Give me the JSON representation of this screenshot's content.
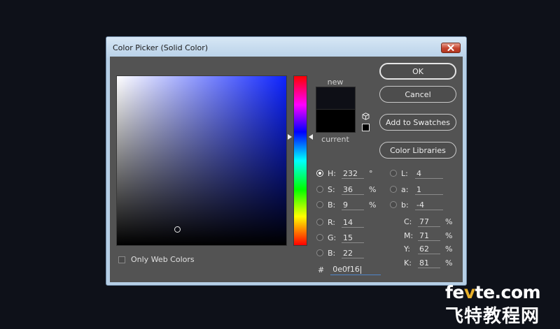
{
  "window": {
    "title": "Color Picker (Solid Color)"
  },
  "preview": {
    "new_label": "new",
    "current_label": "current",
    "new_color": "#0e0f16",
    "current_color": "#000000"
  },
  "buttons": {
    "ok": "OK",
    "cancel": "Cancel",
    "add_swatches": "Add to Swatches",
    "color_libraries": "Color Libraries"
  },
  "hsb": {
    "h": {
      "label": "H:",
      "value": "232",
      "unit": "°",
      "selected": true
    },
    "s": {
      "label": "S:",
      "value": "36",
      "unit": "%"
    },
    "b": {
      "label": "B:",
      "value": "9",
      "unit": "%"
    }
  },
  "rgb": {
    "r": {
      "label": "R:",
      "value": "14"
    },
    "g": {
      "label": "G:",
      "value": "15"
    },
    "b": {
      "label": "B:",
      "value": "22"
    }
  },
  "lab": {
    "l": {
      "label": "L:",
      "value": "4"
    },
    "a": {
      "label": "a:",
      "value": "1"
    },
    "b": {
      "label": "b:",
      "value": "-4"
    }
  },
  "cmyk": {
    "c": {
      "label": "C:",
      "value": "77",
      "unit": "%"
    },
    "m": {
      "label": "M:",
      "value": "71",
      "unit": "%"
    },
    "y": {
      "label": "Y:",
      "value": "62",
      "unit": "%"
    },
    "k": {
      "label": "K:",
      "value": "81",
      "unit": "%"
    }
  },
  "hex": {
    "symbol": "#",
    "value": "0e0f16"
  },
  "web_colors": {
    "label": "Only Web Colors",
    "checked": false
  },
  "watermark": {
    "line1_a": "fe",
    "line1_b": "v",
    "line1_c": "te.com",
    "line2": "飞特教程网"
  }
}
